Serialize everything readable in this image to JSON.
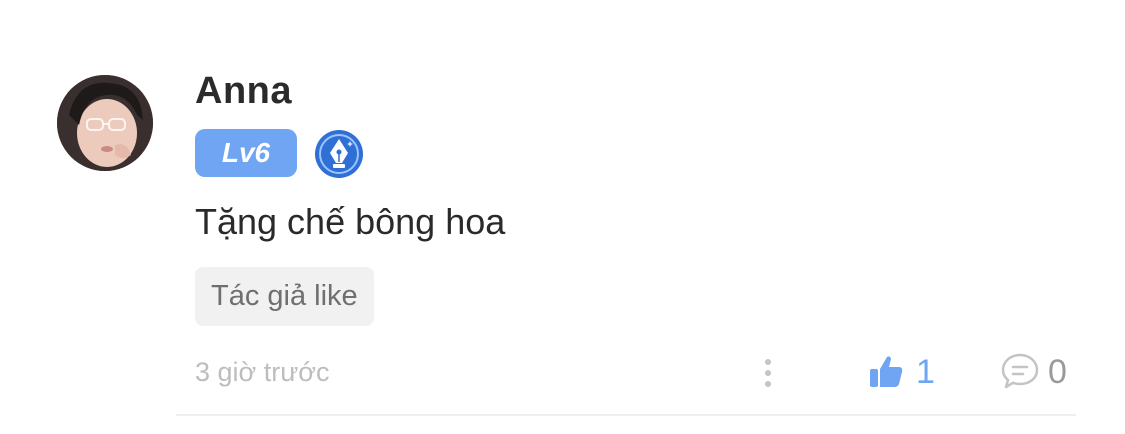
{
  "comment": {
    "username": "Anna",
    "level_badge": "Lv6",
    "author_badge_icon": "fountain-pen-icon",
    "text": "Tặng chế bông hoa",
    "author_liked_label": "Tác giả like",
    "timestamp": "3 giờ trước",
    "likes": "1",
    "replies": "0"
  },
  "colors": {
    "accent": "#6fa5f2",
    "muted": "#bdbdbd"
  }
}
